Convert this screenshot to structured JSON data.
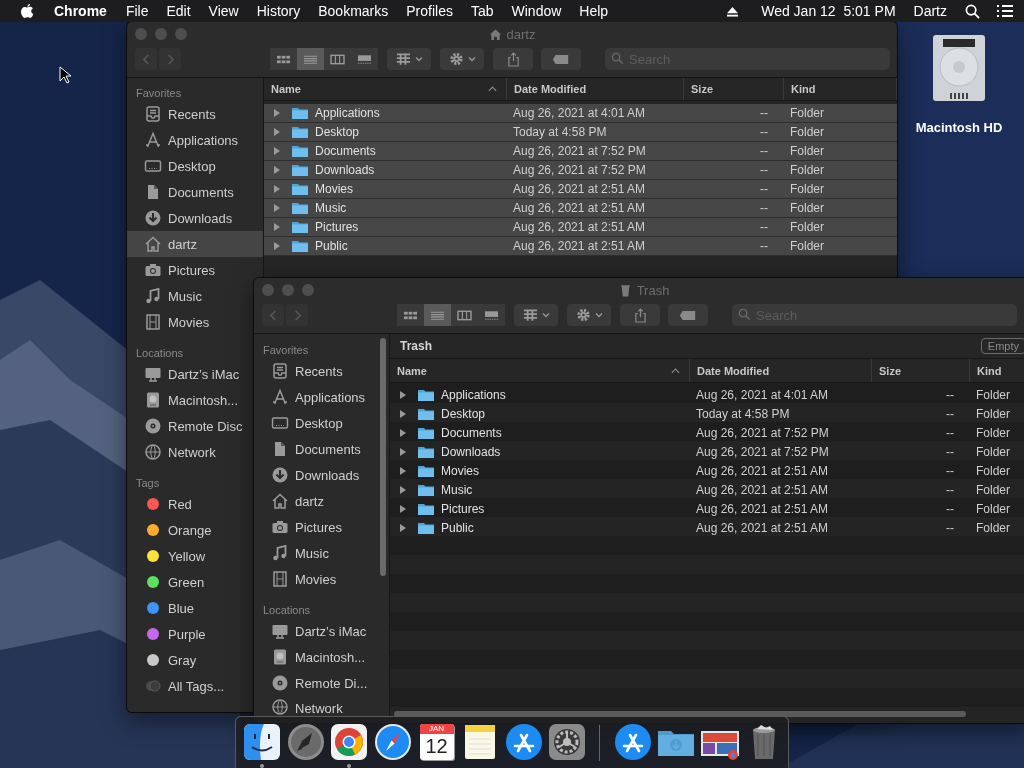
{
  "menu_bar": {
    "app": "Chrome",
    "items": [
      "File",
      "Edit",
      "View",
      "History",
      "Bookmarks",
      "Profiles",
      "Tab",
      "Window",
      "Help"
    ],
    "clock": "Wed Jan 12  5:01 PM",
    "user": "Dartz"
  },
  "desktop_icons": [
    {
      "label": "Macintosh HD"
    }
  ],
  "windows": [
    {
      "title": "dartz",
      "search": {
        "placeholder": "Search"
      },
      "view_modes": [
        {
          "kind": "icons",
          "selected": false
        },
        {
          "kind": "list",
          "selected": true
        },
        {
          "kind": "columns",
          "selected": false
        },
        {
          "kind": "gallery",
          "selected": false
        }
      ],
      "sidebar": [
        {
          "heading": "Favorites",
          "items": [
            {
              "label": "Recents",
              "kind": "recents",
              "selected": false
            },
            {
              "label": "Applications",
              "kind": "applications",
              "selected": false
            },
            {
              "label": "Desktop",
              "kind": "desktop",
              "selected": false
            },
            {
              "label": "Documents",
              "kind": "documents",
              "selected": false
            },
            {
              "label": "Downloads",
              "kind": "downloads",
              "selected": false
            },
            {
              "label": "dartz",
              "kind": "home",
              "selected": true
            },
            {
              "label": "Pictures",
              "kind": "pictures",
              "selected": false
            },
            {
              "label": "Music",
              "kind": "music",
              "selected": false
            },
            {
              "label": "Movies",
              "kind": "movies",
              "selected": false
            }
          ]
        },
        {
          "heading": "Locations",
          "items": [
            {
              "label": "Dartz’s iMac",
              "kind": "computer",
              "selected": false
            },
            {
              "label": "Macintosh...",
              "kind": "disk",
              "selected": false
            },
            {
              "label": "Remote Disc",
              "kind": "disc",
              "selected": false
            },
            {
              "label": "Network",
              "kind": "network",
              "selected": false
            }
          ]
        },
        {
          "heading": "Tags",
          "items": [
            {
              "label": "Red",
              "kind": "tag",
              "color": "#fc5753",
              "selected": false
            },
            {
              "label": "Orange",
              "kind": "tag",
              "color": "#fdab2f",
              "selected": false
            },
            {
              "label": "Yellow",
              "kind": "tag",
              "color": "#fde23c",
              "selected": false
            },
            {
              "label": "Green",
              "kind": "tag",
              "color": "#5ce15c",
              "selected": false
            },
            {
              "label": "Blue",
              "kind": "tag",
              "color": "#3d95f7",
              "selected": false
            },
            {
              "label": "Purple",
              "kind": "tag",
              "color": "#c569e8",
              "selected": false
            },
            {
              "label": "Gray",
              "kind": "tag",
              "color": "#c8c8c8",
              "selected": false
            },
            {
              "label": "All Tags...",
              "kind": "all_tags",
              "selected": false
            }
          ]
        }
      ],
      "columns": [
        "Name",
        "Date Modified",
        "Size",
        "Kind"
      ],
      "rows": [
        {
          "name": "Applications",
          "date": "Aug 26, 2021 at 4:01 AM",
          "size": "--",
          "kind": "Folder",
          "selected": true
        },
        {
          "name": "Desktop",
          "date": "Today at 4:58 PM",
          "size": "--",
          "kind": "Folder",
          "selected": true
        },
        {
          "name": "Documents",
          "date": "Aug 26, 2021 at 7:52 PM",
          "size": "--",
          "kind": "Folder",
          "selected": true
        },
        {
          "name": "Downloads",
          "date": "Aug 26, 2021 at 7:52 PM",
          "size": "--",
          "kind": "Folder",
          "selected": true
        },
        {
          "name": "Movies",
          "date": "Aug 26, 2021 at 2:51 AM",
          "size": "--",
          "kind": "Folder",
          "selected": true
        },
        {
          "name": "Music",
          "date": "Aug 26, 2021 at 2:51 AM",
          "size": "--",
          "kind": "Folder",
          "selected": true
        },
        {
          "name": "Pictures",
          "date": "Aug 26, 2021 at 2:51 AM",
          "size": "--",
          "kind": "Folder",
          "selected": true
        },
        {
          "name": "Public",
          "date": "Aug 26, 2021 at 2:51 AM",
          "size": "--",
          "kind": "Folder",
          "selected": true
        }
      ]
    },
    {
      "title": "Trash",
      "search": {
        "placeholder": "Search"
      },
      "path_bar": {
        "title": "Trash",
        "button": "Empty"
      },
      "view_modes": [
        {
          "kind": "icons",
          "selected": false
        },
        {
          "kind": "list",
          "selected": true
        },
        {
          "kind": "columns",
          "selected": false
        },
        {
          "kind": "gallery",
          "selected": false
        }
      ],
      "sidebar": [
        {
          "heading": "Favorites",
          "items": [
            {
              "label": "Recents",
              "kind": "recents",
              "selected": false
            },
            {
              "label": "Applications",
              "kind": "applications",
              "selected": false
            },
            {
              "label": "Desktop",
              "kind": "desktop",
              "selected": false
            },
            {
              "label": "Documents",
              "kind": "documents",
              "selected": false
            },
            {
              "label": "Downloads",
              "kind": "downloads",
              "selected": false
            },
            {
              "label": "dartz",
              "kind": "home",
              "selected": false
            },
            {
              "label": "Pictures",
              "kind": "pictures",
              "selected": false
            },
            {
              "label": "Music",
              "kind": "music",
              "selected": false
            },
            {
              "label": "Movies",
              "kind": "movies",
              "selected": false
            }
          ]
        },
        {
          "heading": "Locations",
          "items": [
            {
              "label": "Dartz’s iMac",
              "kind": "computer",
              "selected": false
            },
            {
              "label": "Macintosh...",
              "kind": "disk",
              "selected": false
            },
            {
              "label": "Remote Di...",
              "kind": "disc",
              "selected": false
            },
            {
              "label": "Network",
              "kind": "network",
              "selected": false
            }
          ]
        }
      ],
      "columns": [
        "Name",
        "Date Modified",
        "Size",
        "Kind"
      ],
      "rows": [
        {
          "name": "Applications",
          "date": "Aug 26, 2021 at 4:01 AM",
          "size": "--",
          "kind": "Folder",
          "selected": false
        },
        {
          "name": "Desktop",
          "date": "Today at 4:58 PM",
          "size": "--",
          "kind": "Folder",
          "selected": false
        },
        {
          "name": "Documents",
          "date": "Aug 26, 2021 at 7:52 PM",
          "size": "--",
          "kind": "Folder",
          "selected": false
        },
        {
          "name": "Downloads",
          "date": "Aug 26, 2021 at 7:52 PM",
          "size": "--",
          "kind": "Folder",
          "selected": false
        },
        {
          "name": "Movies",
          "date": "Aug 26, 2021 at 2:51 AM",
          "size": "--",
          "kind": "Folder",
          "selected": false
        },
        {
          "name": "Music",
          "date": "Aug 26, 2021 at 2:51 AM",
          "size": "--",
          "kind": "Folder",
          "selected": false
        },
        {
          "name": "Pictures",
          "date": "Aug 26, 2021 at 2:51 AM",
          "size": "--",
          "kind": "Folder",
          "selected": false
        },
        {
          "name": "Public",
          "date": "Aug 26, 2021 at 2:51 AM",
          "size": "--",
          "kind": "Folder",
          "selected": false
        }
      ]
    }
  ],
  "dock": [
    {
      "kind": "finder",
      "running": true
    },
    {
      "kind": "launchpad",
      "running": false
    },
    {
      "kind": "browser",
      "running": true
    },
    {
      "kind": "safari",
      "running": false
    },
    {
      "kind": "calendar",
      "running": false,
      "month": "JAN",
      "day": "12"
    },
    {
      "kind": "notes",
      "running": false
    },
    {
      "kind": "appstore",
      "running": false
    },
    {
      "kind": "settings",
      "running": false
    },
    {
      "kind": "separator"
    },
    {
      "kind": "appstore",
      "running": false
    },
    {
      "kind": "downloads",
      "running": false
    },
    {
      "kind": "screenshot",
      "running": false
    },
    {
      "kind": "trash",
      "running": false
    }
  ]
}
